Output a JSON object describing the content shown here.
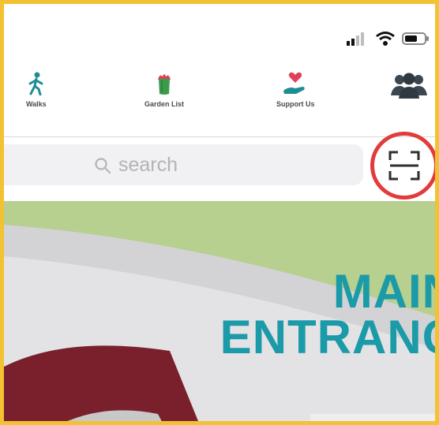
{
  "nav": {
    "items": [
      {
        "label": "Walks",
        "icon": "walking-person-icon"
      },
      {
        "label": "Garden List",
        "icon": "plant-pot-icon"
      },
      {
        "label": "Support Us",
        "icon": "heart-hand-icon"
      },
      {
        "label": "",
        "icon": "people-group-icon"
      }
    ]
  },
  "search": {
    "placeholder": "search"
  },
  "map": {
    "title_line1": "MAIN",
    "title_line2": "ENTRANC"
  },
  "colors": {
    "frame_border": "#f2c233",
    "highlight_circle": "#e23b3b",
    "map_grass": "#b7cf8f",
    "map_path": "#d3d3d5",
    "map_building": "#7a1f2c",
    "title_teal": "#1b9aa8"
  }
}
